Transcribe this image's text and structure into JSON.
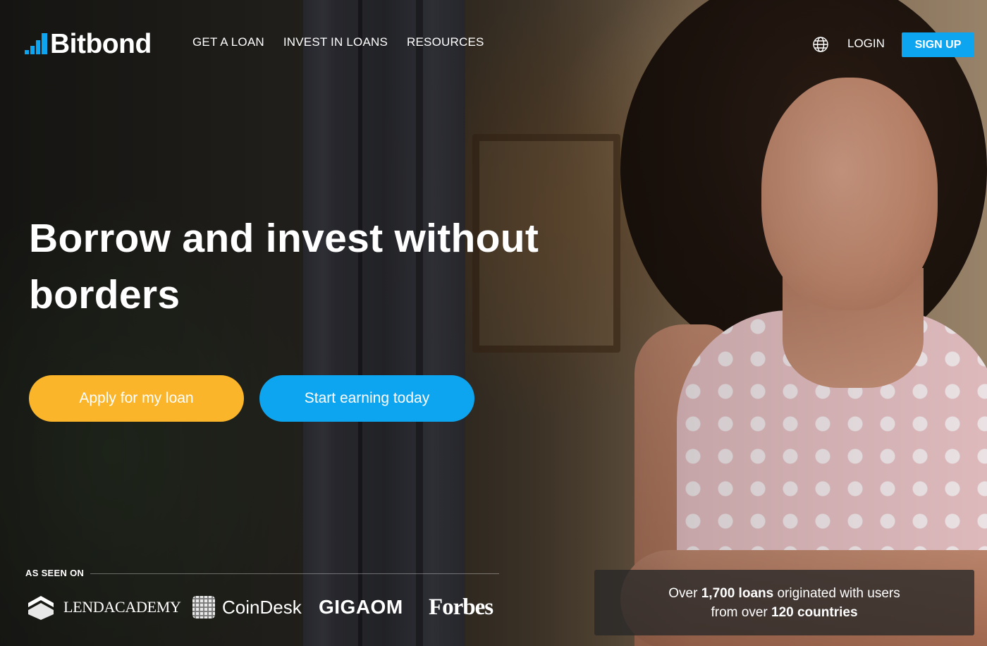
{
  "brand": {
    "name": "Bitbond",
    "accent_color": "#0ea5f0",
    "cta_yellow": "#fbb52a"
  },
  "nav": {
    "links": [
      "GET A LOAN",
      "INVEST IN LOANS",
      "RESOURCES"
    ],
    "language_icon": "globe-icon",
    "login_label": "LOGIN",
    "signup_label": "SIGN UP"
  },
  "hero": {
    "headline": "Borrow and invest without borders",
    "apply_button": "Apply for my loan",
    "earn_button": "Start earning today"
  },
  "press": {
    "label": "AS SEEN ON",
    "logos": [
      "LENDACADEMY",
      "CoinDesk",
      "GIGAOM",
      "Forbes"
    ]
  },
  "stats": {
    "line1_prefix": "Over",
    "loans_count": "1,700 loans",
    "line1_suffix": "originated with users",
    "line2_prefix": "from over",
    "countries_count": "120 countries"
  }
}
